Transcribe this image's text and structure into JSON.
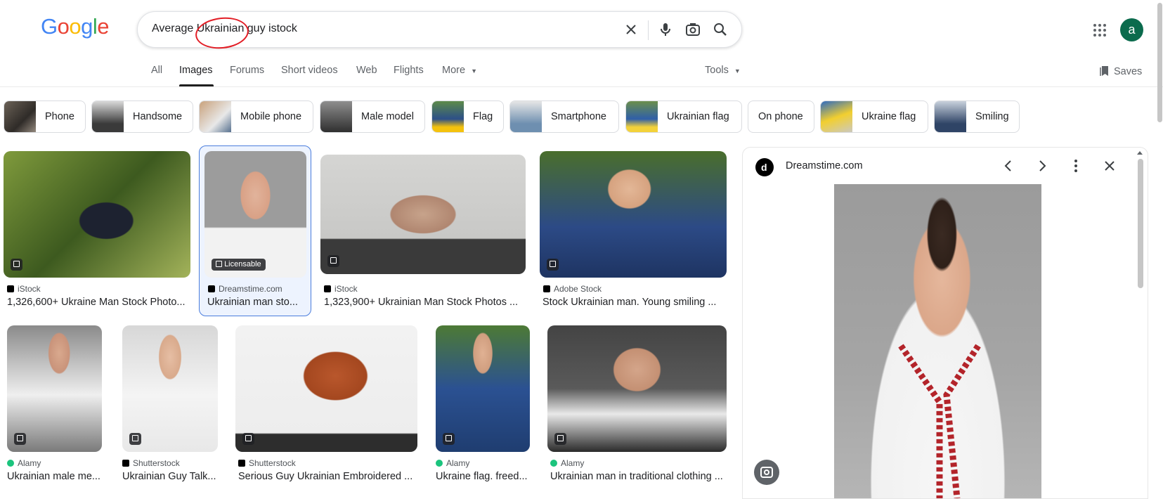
{
  "header": {
    "logo": "Google",
    "search_query": "Average Ukrainian guy istock",
    "avatar_letter": "a"
  },
  "tabs": {
    "items": [
      "All",
      "Images",
      "Forums",
      "Short videos",
      "Web",
      "Flights",
      "More"
    ],
    "active": "Images",
    "tools_label": "Tools",
    "saves_label": "Saves"
  },
  "chips": [
    {
      "label": "Phone"
    },
    {
      "label": "Handsome"
    },
    {
      "label": "Mobile phone"
    },
    {
      "label": "Male model"
    },
    {
      "label": "Flag"
    },
    {
      "label": "Smartphone"
    },
    {
      "label": "Ukrainian flag"
    },
    {
      "label": "On phone"
    },
    {
      "label": "Ukraine flag"
    },
    {
      "label": "Smiling"
    }
  ],
  "results": [
    {
      "source": "iStock",
      "title": "1,326,600+ Ukraine Man Stock Photo...",
      "badge": ""
    },
    {
      "source": "Dreamstime.com",
      "title": "Ukrainian man sto...",
      "badge": "Licensable"
    },
    {
      "source": "iStock",
      "title": "1,323,900+ Ukrainian Man Stock Photos ...",
      "badge": ""
    },
    {
      "source": "Adobe Stock",
      "title": "Stock Ukrainian man. Young smiling ...",
      "badge": ""
    },
    {
      "source": "Alamy",
      "title": "Ukrainian male me...",
      "badge": ""
    },
    {
      "source": "Shutterstock",
      "title": "Ukrainian Guy Talk...",
      "badge": ""
    },
    {
      "source": "Shutterstock",
      "title": "Serious Guy Ukrainian Embroidered ...",
      "badge": ""
    },
    {
      "source": "Alamy",
      "title": "Ukraine flag. freed...",
      "badge": ""
    },
    {
      "source": "Alamy",
      "title": "Ukrainian man in traditional clothing ...",
      "badge": ""
    }
  ],
  "panel": {
    "source": "Dreamstime.com"
  },
  "colors": {
    "selected_border": "#4a7ddd",
    "annotation_red": "#e21e26",
    "avatar_bg": "#0b6b4d"
  }
}
